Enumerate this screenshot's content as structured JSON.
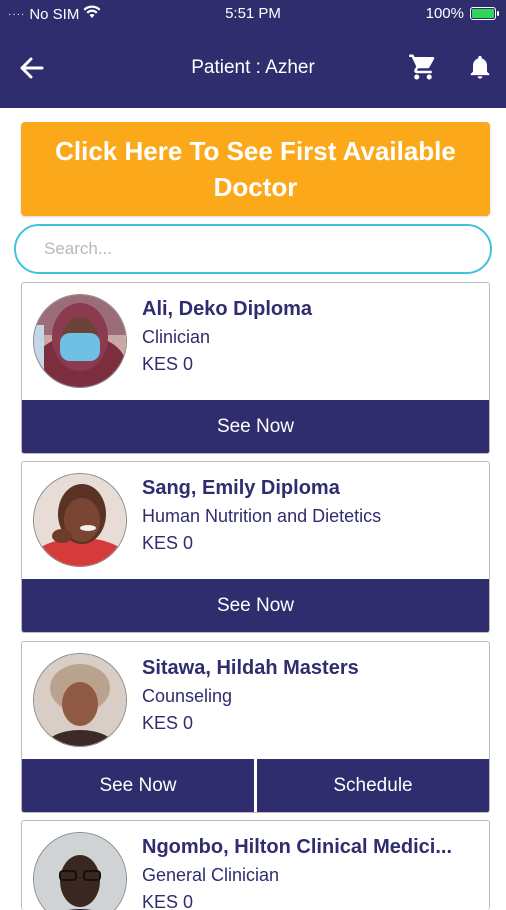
{
  "status_bar": {
    "carrier": "No SIM",
    "time": "5:51 PM",
    "battery": "100%"
  },
  "header": {
    "title": "Patient : Azher"
  },
  "first_available": {
    "label": "Click Here To See First Available Doctor"
  },
  "search": {
    "placeholder": "Search...",
    "value": ""
  },
  "doctors": [
    {
      "name": "Ali, Deko Diploma",
      "specialty": "Clinician",
      "price": "KES 0",
      "actions": [
        "See Now"
      ]
    },
    {
      "name": "Sang, Emily Diploma",
      "specialty": "Human Nutrition and Dietetics",
      "price": "KES 0",
      "actions": [
        "See Now"
      ]
    },
    {
      "name": "Sitawa, Hildah Masters",
      "specialty": "Counseling",
      "price": "KES 0",
      "actions": [
        "See Now",
        "Schedule"
      ]
    },
    {
      "name": "Ngombo, Hilton Clinical Medici...",
      "specialty": "General Clinician",
      "price": "KES 0",
      "actions": []
    }
  ],
  "colors": {
    "header": "#2f2d6e",
    "accent": "#fba91b",
    "search_border": "#3fc3d9",
    "battery": "#2fd65a"
  },
  "icons": {
    "back": "arrow-left-icon",
    "cart": "cart-icon",
    "bell": "bell-icon",
    "wifi": "wifi-icon",
    "battery": "battery-icon"
  }
}
